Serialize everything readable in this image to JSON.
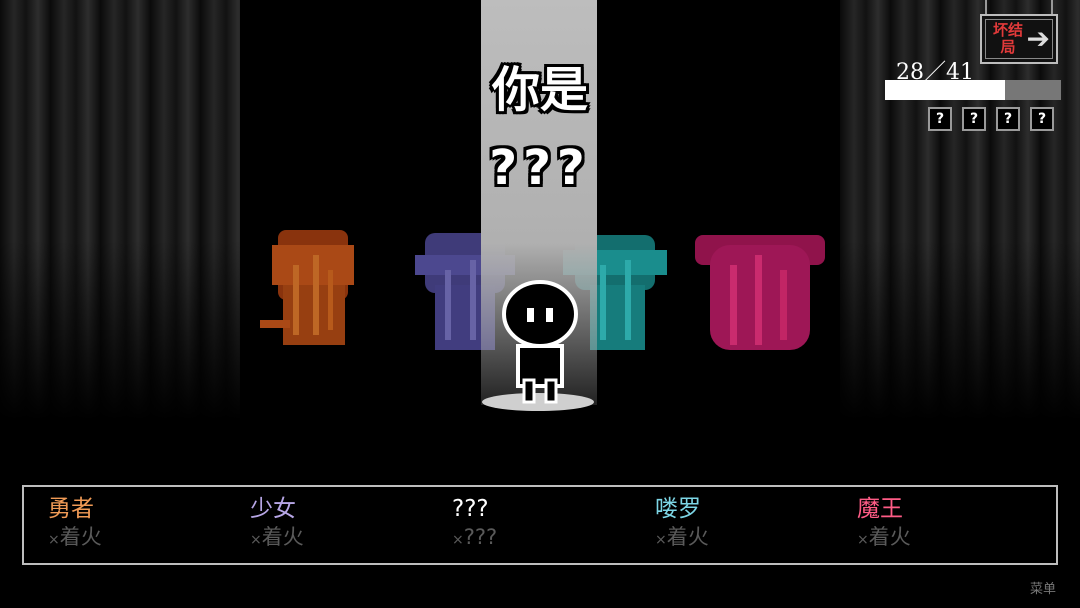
{
  "scene": {
    "title_line1": "你是",
    "title_line2": "???"
  },
  "bad_ending_button": {
    "label": "坏结局",
    "arrow": "➔"
  },
  "progress": {
    "text": "28／41",
    "current": 28,
    "total": 41,
    "unknown_slots": [
      "?",
      "?",
      "?",
      "?"
    ]
  },
  "characters": [
    {
      "name": "勇者",
      "status_mark": "×",
      "status": "着火",
      "color": "#f09a55"
    },
    {
      "name": "少女",
      "status_mark": "×",
      "status": "着火",
      "color": "#b7a6e6"
    },
    {
      "name": "???",
      "status_mark": "×",
      "status": "???",
      "color": "#ffffff"
    },
    {
      "name": "喽罗",
      "status_mark": "×",
      "status": "着火",
      "color": "#7dd6e6"
    },
    {
      "name": "魔王",
      "status_mark": "×",
      "status": "着火",
      "color": "#ff5c86"
    }
  ],
  "menu": {
    "label": "菜单"
  },
  "colors": {
    "hero_ghost": "#c8561a",
    "girl_ghost": "#5a55a8",
    "minion_ghost": "#1fa6a6",
    "demon_ghost": "#c01a66"
  }
}
